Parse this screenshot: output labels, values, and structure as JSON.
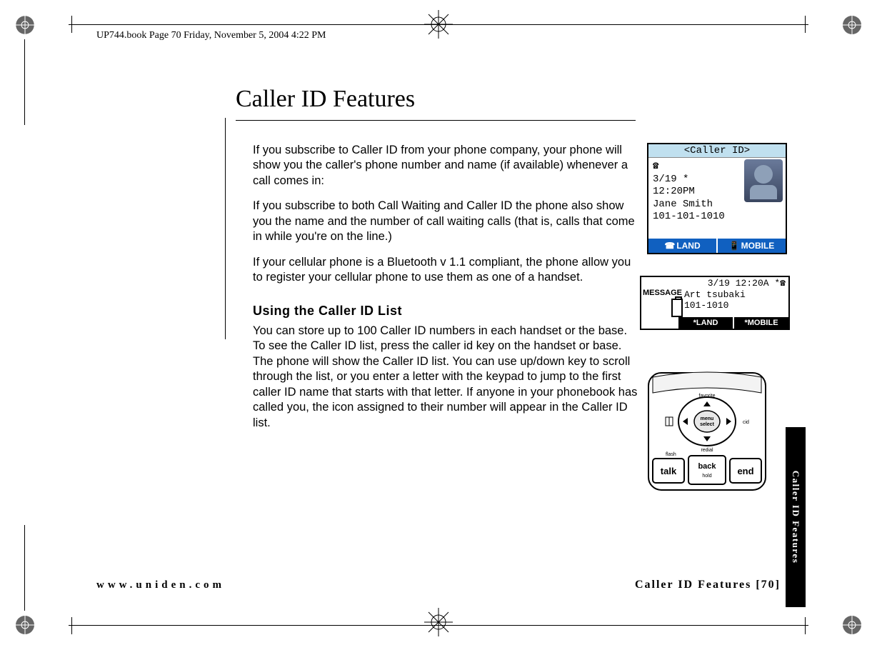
{
  "running_header": "UP744.book  Page 70  Friday, November 5, 2004  4:22 PM",
  "title": "Caller ID Features",
  "para1": "If you subscribe to Caller ID from your phone company, your phone will show you the caller's phone number and name (if available) whenever a call comes in:",
  "para2": "If you subscribe to both Call Waiting and Caller ID the phone also show you the name and the number of call waiting calls (that is, calls that come in while you're on the line.)",
  "para3": "If your cellular phone is a Bluetooth v 1.1 compliant, the phone allow you to register your cellular phone to use them as one of a handset.",
  "subhead": "Using the Caller ID List",
  "para4": "You can store up to 100 Caller ID numbers in each handset or the base. To see the Caller ID list, press the caller id key on the handset or base. The phone will show the Caller ID list. You can use up/down key to scroll through the list, or you enter a letter with the keypad to jump to the first caller ID name that starts with that letter. If anyone in your phonebook has called you, the icon assigned to their number will appear in the Caller ID list.",
  "footer_left": "www.uniden.com",
  "footer_right": "Caller ID Features [70]",
  "sidetab": "Caller ID Features",
  "screen1": {
    "title": "<Caller ID>",
    "line_date": " 3/19 *",
    "line_time": "12:20PM",
    "line_name": "Jane Smith",
    "line_num": "101-101-1010",
    "sk_left": "LAND",
    "sk_right": "MOBILE"
  },
  "screen2": {
    "top": "3/19 12:20A *",
    "badge": "MESSAGE",
    "name": "Art tsubaki",
    "num": "101-1010",
    "sk_left": "*LAND",
    "sk_right": "*MOBILE"
  },
  "keypad": {
    "favorite": "favorite",
    "cid": "cid",
    "flash": "flash",
    "redial": "redial",
    "talk": "talk",
    "back": "back",
    "hold": "hold",
    "end": "end",
    "menu": "menu",
    "select": "select"
  }
}
